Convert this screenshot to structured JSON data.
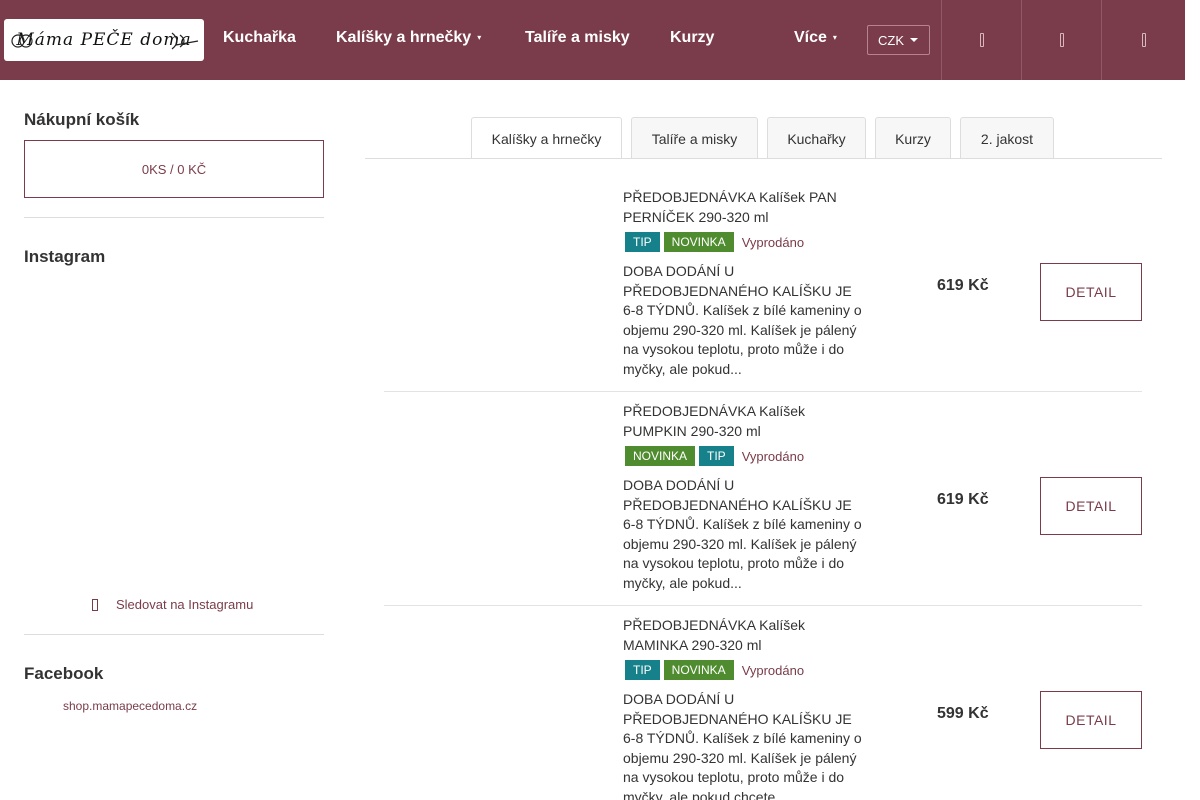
{
  "header": {
    "logo_text": "Máma PEČE doma",
    "nav": [
      {
        "label": "Kuchařka"
      },
      {
        "label": "Kalíšky a hrnečky"
      },
      {
        "label": "Talíře a misky"
      },
      {
        "label": "Kurzy"
      },
      {
        "label": "Více"
      }
    ],
    "currency": "CZK"
  },
  "sidebar": {
    "cart_title": "Nákupní košík",
    "cart_summary": "0KS / 0 KČ",
    "instagram_title": "Instagram",
    "instagram_follow": "Sledovat na Instagramu",
    "facebook_title": "Facebook",
    "facebook_link": "shop.mamapecedoma.cz"
  },
  "tabs": [
    {
      "label": "Kalíšky a hrnečky"
    },
    {
      "label": "Talíře a misky"
    },
    {
      "label": "Kuchařky"
    },
    {
      "label": "Kurzy"
    },
    {
      "label": "2. jakost"
    }
  ],
  "products": [
    {
      "title": "PŘEDOBJEDNÁVKA Kalíšek PAN PERNÍČEK 290-320 ml",
      "badge1": "TIP",
      "badge2": "NOVINKA",
      "status": "Vyprodáno",
      "description": "DOBA DODÁNÍ U PŘEDOBJEDNANÉHO KALÍŠKU JE 6-8 TÝDNŮ. Kalíšek z bílé kameniny o objemu 290-320 ml. Kalíšek je pálený na vysokou teplotu, proto může i do myčky, ale pokud...",
      "price": "619 Kč",
      "detail_label": "DETAIL"
    },
    {
      "title": "PŘEDOBJEDNÁVKA Kalíšek PUMPKIN 290-320 ml",
      "badge1": "NOVINKA",
      "badge2": "TIP",
      "status": "Vyprodáno",
      "description": "DOBA DODÁNÍ U PŘEDOBJEDNANÉHO KALÍŠKU JE 6-8 TÝDNŮ. Kalíšek z bílé kameniny o objemu 290-320 ml. Kalíšek je pálený na vysokou teplotu, proto může i do myčky, ale pokud...",
      "price": "619 Kč",
      "detail_label": "DETAIL"
    },
    {
      "title": "PŘEDOBJEDNÁVKA Kalíšek MAMINKA 290-320 ml",
      "badge1": "TIP",
      "badge2": "NOVINKA",
      "status": "Vyprodáno",
      "description": "DOBA DODÁNÍ U PŘEDOBJEDNANÉHO KALÍŠKU JE 6-8 TÝDNŮ. Kalíšek z bílé kameniny o objemu 290-320 ml. Kalíšek je pálený na vysokou teplotu, proto může i do myčky, ale pokud chcete...",
      "price": "599 Kč",
      "detail_label": "DETAIL"
    }
  ],
  "colors": {
    "brand": "#7a3c4a",
    "tip_badge": "#17818b",
    "new_badge": "#4f8c2f"
  }
}
